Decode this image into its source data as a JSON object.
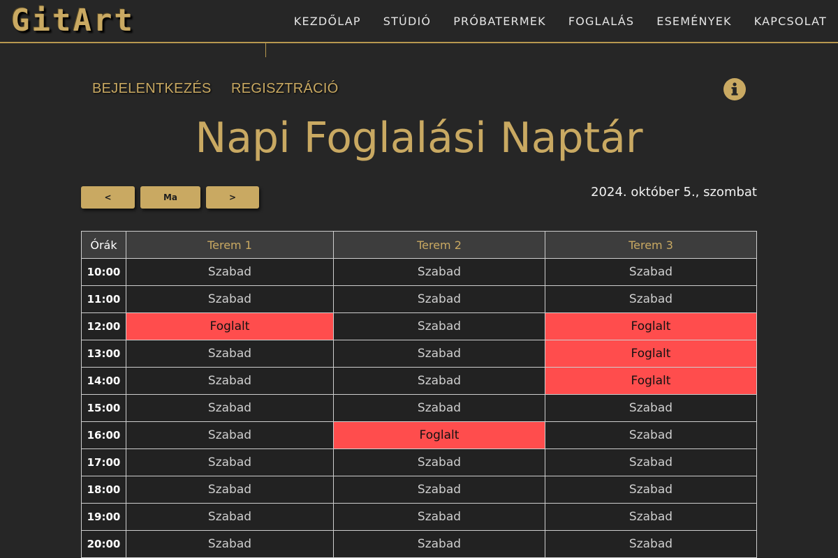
{
  "brand": {
    "logo": "GitArt",
    "accent": "#c9a962"
  },
  "nav": [
    {
      "label": "KEZDŐLAP"
    },
    {
      "label": "STÚDIÓ"
    },
    {
      "label": "PRÓBATERMEK"
    },
    {
      "label": "FOGLALÁS"
    },
    {
      "label": "ESEMÉNYEK"
    },
    {
      "label": "KAPCSOLAT"
    }
  ],
  "auth": {
    "login": "BEJELENTKEZÉS",
    "register": "REGISZTRÁCIÓ"
  },
  "info_icon": "info-icon",
  "title": "Napi Foglalási Naptár",
  "controls": {
    "prev": "<",
    "today": "Ma",
    "next": ">"
  },
  "date": "2024. október 5., szombat",
  "table": {
    "hours_header": "Órák",
    "rooms": [
      "Terem 1",
      "Terem 2",
      "Terem 3"
    ],
    "status_colors": {
      "Foglalt": "#ff4d4d",
      "Szabad": "#222222"
    },
    "rows": [
      {
        "hour": "10:00",
        "slots": [
          "Szabad",
          "Szabad",
          "Szabad"
        ]
      },
      {
        "hour": "11:00",
        "slots": [
          "Szabad",
          "Szabad",
          "Szabad"
        ]
      },
      {
        "hour": "12:00",
        "slots": [
          "Foglalt",
          "Szabad",
          "Foglalt"
        ]
      },
      {
        "hour": "13:00",
        "slots": [
          "Szabad",
          "Szabad",
          "Foglalt"
        ]
      },
      {
        "hour": "14:00",
        "slots": [
          "Szabad",
          "Szabad",
          "Foglalt"
        ]
      },
      {
        "hour": "15:00",
        "slots": [
          "Szabad",
          "Szabad",
          "Szabad"
        ]
      },
      {
        "hour": "16:00",
        "slots": [
          "Szabad",
          "Foglalt",
          "Szabad"
        ]
      },
      {
        "hour": "17:00",
        "slots": [
          "Szabad",
          "Szabad",
          "Szabad"
        ]
      },
      {
        "hour": "18:00",
        "slots": [
          "Szabad",
          "Szabad",
          "Szabad"
        ]
      },
      {
        "hour": "19:00",
        "slots": [
          "Szabad",
          "Szabad",
          "Szabad"
        ]
      },
      {
        "hour": "20:00",
        "slots": [
          "Szabad",
          "Szabad",
          "Szabad"
        ]
      }
    ]
  }
}
